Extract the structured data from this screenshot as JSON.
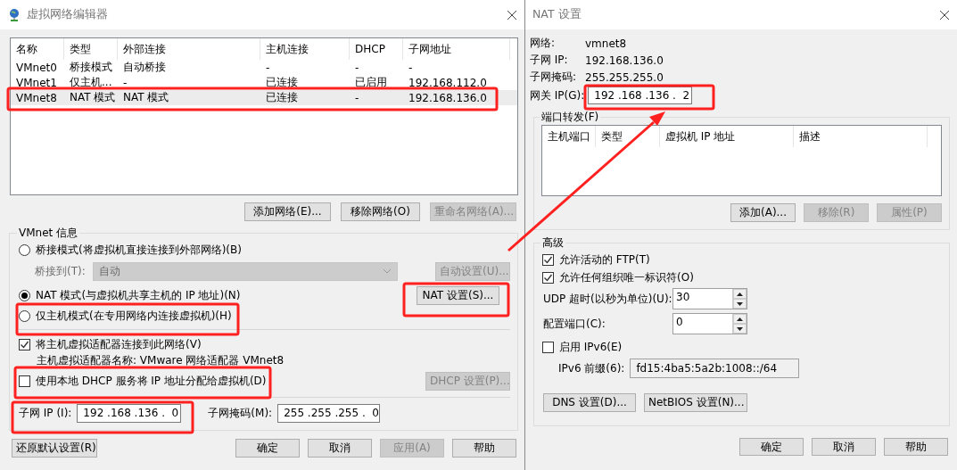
{
  "editor": {
    "title": "虚拟网络编辑器",
    "table": {
      "columns": [
        "名称",
        "类型",
        "外部连接",
        "主机连接",
        "DHCP",
        "子网地址"
      ],
      "rows": [
        {
          "cells": [
            "VMnet0",
            "桥接模式",
            "自动桥接",
            "-",
            "-",
            "-"
          ],
          "selected": false
        },
        {
          "cells": [
            "VMnet1",
            "仅主机...",
            "-",
            "已连接",
            "已启用",
            "192.168.112.0"
          ],
          "selected": false
        },
        {
          "cells": [
            "VMnet8",
            "NAT 模式",
            "NAT 模式",
            "已连接",
            "-",
            "192.168.136.0"
          ],
          "selected": true
        }
      ]
    },
    "list_buttons": [
      {
        "label": "添加网络(E)...",
        "disabled": false
      },
      {
        "label": "移除网络(O)",
        "disabled": false
      },
      {
        "label": "重命名网络(A)...",
        "disabled": true
      }
    ],
    "info": {
      "title": "VMnet 信息",
      "modes": [
        {
          "label": "桥接模式(将虚拟机直接连接到外部网络)(B)",
          "selected": false
        },
        {
          "label": "NAT 模式(与虚拟机共享主机的 IP 地址)(N)",
          "selected": true
        },
        {
          "label": "仅主机模式(在专用网络内连接虚拟机)(H)",
          "selected": false
        }
      ],
      "bridge_to": {
        "label": "桥接到(T):",
        "value": "自动",
        "disabled": true
      },
      "auto_button": {
        "label": "自动设置(U)...",
        "disabled": true
      },
      "nat_button": {
        "label": "NAT 设置(S)...",
        "disabled": false
      },
      "connect_adapter": {
        "label": "将主机虚拟适配器连接到此网络(V)",
        "checked": true
      },
      "adapter_name": "主机虚拟适配器名称: VMware 网络适配器 VMnet8",
      "dhcp": {
        "label": "使用本地 DHCP 服务将 IP 地址分配给虚拟机(D)",
        "checked": false
      },
      "dhcp_button": {
        "label": "DHCP 设置(P)...",
        "disabled": true
      },
      "subnet_ip": {
        "label": "子网 IP (I):",
        "value": "192 .168 .136 .  0"
      },
      "subnet_mask": {
        "label": "子网掩码(M):",
        "value": "255 .255 .255 .  0"
      }
    },
    "footer_buttons": [
      {
        "label": "还原默认设置(R)",
        "disabled": false
      },
      {
        "label": "确定",
        "disabled": false
      },
      {
        "label": "取消",
        "disabled": false
      },
      {
        "label": "应用(A)",
        "disabled": true
      },
      {
        "label": "帮助",
        "disabled": false
      }
    ]
  },
  "nat": {
    "title": "NAT 设置",
    "info": [
      {
        "label": "网络:",
        "value": "vmnet8"
      },
      {
        "label": "子网 IP:",
        "value": "192.168.136.0"
      },
      {
        "label": "子网掩码:",
        "value": "255.255.255.0"
      }
    ],
    "gateway": {
      "label": "网关 IP(G):",
      "value": "192 .168 .136 .  2"
    },
    "port_forwarding": {
      "title": "端口转发(F)",
      "columns": [
        "主机端口",
        "类型",
        "虚拟机 IP 地址",
        "描述"
      ],
      "buttons": [
        {
          "label": "添加(A)...",
          "disabled": false
        },
        {
          "label": "移除(R)",
          "disabled": true
        },
        {
          "label": "属性(P)",
          "disabled": true
        }
      ]
    },
    "advanced": {
      "title": "高级",
      "checks": [
        {
          "label": "允许活动的 FTP(T)",
          "checked": true
        },
        {
          "label": "允许任何组织唯一标识符(O)",
          "checked": true
        }
      ],
      "spins": [
        {
          "label": "UDP 超时(以秒为单位)(U):",
          "value": "30"
        },
        {
          "label": "配置端口(C):",
          "value": "0"
        }
      ],
      "ipv6": {
        "label": "启用 IPv6(E)",
        "checked": false
      },
      "prefix": {
        "label": "IPv6 前缀(6):",
        "value": "fd15:4ba5:5a2b:1008::/64"
      },
      "buttons": [
        {
          "label": "DNS 设置(D)...",
          "disabled": false
        },
        {
          "label": "NetBIOS 设置(N)...",
          "disabled": false
        }
      ]
    },
    "footer_buttons": [
      {
        "label": "确定",
        "disabled": false
      },
      {
        "label": "取消",
        "disabled": false
      },
      {
        "label": "帮助",
        "disabled": false
      }
    ]
  }
}
